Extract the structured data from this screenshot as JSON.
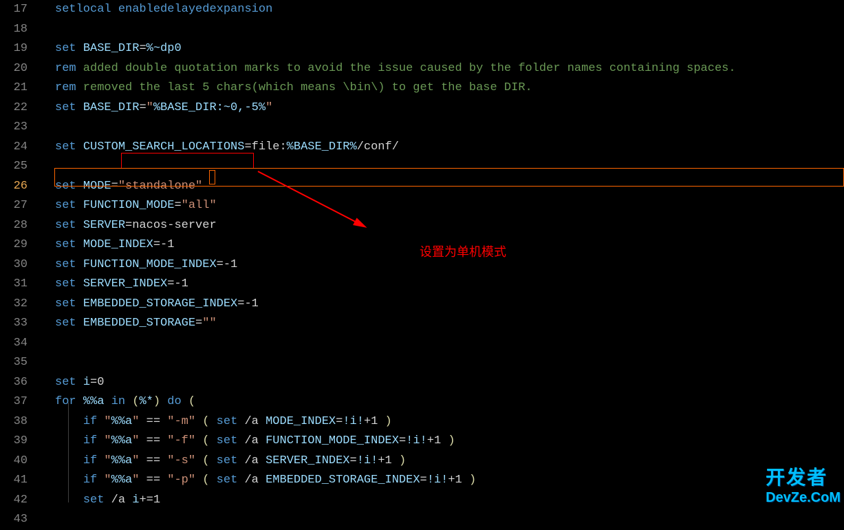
{
  "annotation_text": "设置为单机模式",
  "watermark_cn": "开发者",
  "watermark_en": "DevZe.CoM",
  "line_numbers": [
    "17",
    "18",
    "19",
    "20",
    "21",
    "22",
    "23",
    "24",
    "25",
    "26",
    "27",
    "28",
    "29",
    "30",
    "31",
    "32",
    "33",
    "34",
    "35",
    "36",
    "37",
    "38",
    "39",
    "40",
    "41",
    "42",
    "43"
  ],
  "active_line_index": 9,
  "tokens": {
    "l17": [
      {
        "t": "setlocal",
        "c": "kw-blue"
      },
      {
        "t": " ",
        "c": "kw-white"
      },
      {
        "t": "enabledelayedexpansion",
        "c": "kw-blue"
      }
    ],
    "l18": [],
    "l19": [
      {
        "t": "set",
        "c": "kw-blue"
      },
      {
        "t": " ",
        "c": "kw-white"
      },
      {
        "t": "BASE_DIR",
        "c": "kw-cyan"
      },
      {
        "t": "=",
        "c": "kw-white"
      },
      {
        "t": "%~dp0",
        "c": "kw-cyan"
      }
    ],
    "l20": [
      {
        "t": "rem",
        "c": "kw-blue"
      },
      {
        "t": " added double quotation marks to avoid the issue caused by the folder names containing spaces.",
        "c": "kw-green"
      }
    ],
    "l21": [
      {
        "t": "rem",
        "c": "kw-blue"
      },
      {
        "t": " removed the last 5 chars(which means \\bin\\) to get the base DIR.",
        "c": "kw-green"
      }
    ],
    "l22": [
      {
        "t": "set",
        "c": "kw-blue"
      },
      {
        "t": " ",
        "c": "kw-white"
      },
      {
        "t": "BASE_DIR",
        "c": "kw-cyan"
      },
      {
        "t": "=",
        "c": "kw-white"
      },
      {
        "t": "\"",
        "c": "kw-orange"
      },
      {
        "t": "%BASE_DIR:~0,-5%",
        "c": "kw-cyan"
      },
      {
        "t": "\"",
        "c": "kw-orange"
      }
    ],
    "l23": [],
    "l24": [
      {
        "t": "set",
        "c": "kw-blue"
      },
      {
        "t": " ",
        "c": "kw-white"
      },
      {
        "t": "CUSTOM_SEARCH_LOCATIONS",
        "c": "kw-cyan"
      },
      {
        "t": "=file:",
        "c": "kw-white"
      },
      {
        "t": "%BASE_DIR%",
        "c": "kw-cyan"
      },
      {
        "t": "/conf/",
        "c": "kw-white"
      }
    ],
    "l25": [],
    "l26": [
      {
        "t": "set",
        "c": "kw-blue"
      },
      {
        "t": " ",
        "c": "kw-white"
      },
      {
        "t": "MODE",
        "c": "kw-cyan"
      },
      {
        "t": "=",
        "c": "kw-white"
      },
      {
        "t": "\"standalone\"",
        "c": "kw-orange"
      }
    ],
    "l27": [
      {
        "t": "set",
        "c": "kw-blue"
      },
      {
        "t": " ",
        "c": "kw-white"
      },
      {
        "t": "FUNCTION_MODE",
        "c": "kw-cyan"
      },
      {
        "t": "=",
        "c": "kw-white"
      },
      {
        "t": "\"all\"",
        "c": "kw-orange"
      }
    ],
    "l28": [
      {
        "t": "set",
        "c": "kw-blue"
      },
      {
        "t": " ",
        "c": "kw-white"
      },
      {
        "t": "SERVER",
        "c": "kw-cyan"
      },
      {
        "t": "=nacos-server",
        "c": "kw-white"
      }
    ],
    "l29": [
      {
        "t": "set",
        "c": "kw-blue"
      },
      {
        "t": " ",
        "c": "kw-white"
      },
      {
        "t": "MODE_INDEX",
        "c": "kw-cyan"
      },
      {
        "t": "=-1",
        "c": "kw-white"
      }
    ],
    "l30": [
      {
        "t": "set",
        "c": "kw-blue"
      },
      {
        "t": " ",
        "c": "kw-white"
      },
      {
        "t": "FUNCTION_MODE_INDEX",
        "c": "kw-cyan"
      },
      {
        "t": "=-1",
        "c": "kw-white"
      }
    ],
    "l31": [
      {
        "t": "set",
        "c": "kw-blue"
      },
      {
        "t": " ",
        "c": "kw-white"
      },
      {
        "t": "SERVER_INDEX",
        "c": "kw-cyan"
      },
      {
        "t": "=-1",
        "c": "kw-white"
      }
    ],
    "l32": [
      {
        "t": "set",
        "c": "kw-blue"
      },
      {
        "t": " ",
        "c": "kw-white"
      },
      {
        "t": "EMBEDDED_STORAGE_INDEX",
        "c": "kw-cyan"
      },
      {
        "t": "=-1",
        "c": "kw-white"
      }
    ],
    "l33": [
      {
        "t": "set",
        "c": "kw-blue"
      },
      {
        "t": " ",
        "c": "kw-white"
      },
      {
        "t": "EMBEDDED_STORAGE",
        "c": "kw-cyan"
      },
      {
        "t": "=",
        "c": "kw-white"
      },
      {
        "t": "\"\"",
        "c": "kw-orange"
      }
    ],
    "l34": [],
    "l35": [],
    "l36": [
      {
        "t": "set",
        "c": "kw-blue"
      },
      {
        "t": " ",
        "c": "kw-white"
      },
      {
        "t": "i",
        "c": "kw-cyan"
      },
      {
        "t": "=0",
        "c": "kw-white"
      }
    ],
    "l37": [
      {
        "t": "for",
        "c": "kw-blue"
      },
      {
        "t": " ",
        "c": "kw-white"
      },
      {
        "t": "%%a",
        "c": "kw-cyan"
      },
      {
        "t": " ",
        "c": "kw-white"
      },
      {
        "t": "in",
        "c": "kw-blue"
      },
      {
        "t": " (",
        "c": "kw-yellow"
      },
      {
        "t": "%*",
        "c": "kw-cyan"
      },
      {
        "t": ") ",
        "c": "kw-yellow"
      },
      {
        "t": "do",
        "c": "kw-blue"
      },
      {
        "t": " (",
        "c": "kw-yellow"
      }
    ],
    "l38": [
      {
        "t": "    ",
        "c": "kw-white"
      },
      {
        "t": "if",
        "c": "kw-blue"
      },
      {
        "t": " ",
        "c": "kw-white"
      },
      {
        "t": "\"",
        "c": "kw-orange"
      },
      {
        "t": "%%a",
        "c": "kw-cyan"
      },
      {
        "t": "\"",
        "c": "kw-orange"
      },
      {
        "t": " == ",
        "c": "kw-white"
      },
      {
        "t": "\"-m\"",
        "c": "kw-orange"
      },
      {
        "t": " ( ",
        "c": "kw-yellow"
      },
      {
        "t": "set",
        "c": "kw-blue"
      },
      {
        "t": " /a ",
        "c": "kw-white"
      },
      {
        "t": "MODE_INDEX",
        "c": "kw-cyan"
      },
      {
        "t": "=",
        "c": "kw-white"
      },
      {
        "t": "!i!",
        "c": "kw-cyan"
      },
      {
        "t": "+1 ",
        "c": "kw-white"
      },
      {
        "t": ")",
        "c": "kw-yellow"
      }
    ],
    "l39": [
      {
        "t": "    ",
        "c": "kw-white"
      },
      {
        "t": "if",
        "c": "kw-blue"
      },
      {
        "t": " ",
        "c": "kw-white"
      },
      {
        "t": "\"",
        "c": "kw-orange"
      },
      {
        "t": "%%a",
        "c": "kw-cyan"
      },
      {
        "t": "\"",
        "c": "kw-orange"
      },
      {
        "t": " == ",
        "c": "kw-white"
      },
      {
        "t": "\"-f\"",
        "c": "kw-orange"
      },
      {
        "t": " ( ",
        "c": "kw-yellow"
      },
      {
        "t": "set",
        "c": "kw-blue"
      },
      {
        "t": " /a ",
        "c": "kw-white"
      },
      {
        "t": "FUNCTION_MODE_INDEX",
        "c": "kw-cyan"
      },
      {
        "t": "=",
        "c": "kw-white"
      },
      {
        "t": "!i!",
        "c": "kw-cyan"
      },
      {
        "t": "+1 ",
        "c": "kw-white"
      },
      {
        "t": ")",
        "c": "kw-yellow"
      }
    ],
    "l40": [
      {
        "t": "    ",
        "c": "kw-white"
      },
      {
        "t": "if",
        "c": "kw-blue"
      },
      {
        "t": " ",
        "c": "kw-white"
      },
      {
        "t": "\"",
        "c": "kw-orange"
      },
      {
        "t": "%%a",
        "c": "kw-cyan"
      },
      {
        "t": "\"",
        "c": "kw-orange"
      },
      {
        "t": " == ",
        "c": "kw-white"
      },
      {
        "t": "\"-s\"",
        "c": "kw-orange"
      },
      {
        "t": " ( ",
        "c": "kw-yellow"
      },
      {
        "t": "set",
        "c": "kw-blue"
      },
      {
        "t": " /a ",
        "c": "kw-white"
      },
      {
        "t": "SERVER_INDEX",
        "c": "kw-cyan"
      },
      {
        "t": "=",
        "c": "kw-white"
      },
      {
        "t": "!i!",
        "c": "kw-cyan"
      },
      {
        "t": "+1 ",
        "c": "kw-white"
      },
      {
        "t": ")",
        "c": "kw-yellow"
      }
    ],
    "l41": [
      {
        "t": "    ",
        "c": "kw-white"
      },
      {
        "t": "if",
        "c": "kw-blue"
      },
      {
        "t": " ",
        "c": "kw-white"
      },
      {
        "t": "\"",
        "c": "kw-orange"
      },
      {
        "t": "%%a",
        "c": "kw-cyan"
      },
      {
        "t": "\"",
        "c": "kw-orange"
      },
      {
        "t": " == ",
        "c": "kw-white"
      },
      {
        "t": "\"-p\"",
        "c": "kw-orange"
      },
      {
        "t": " ( ",
        "c": "kw-yellow"
      },
      {
        "t": "set",
        "c": "kw-blue"
      },
      {
        "t": " /a ",
        "c": "kw-white"
      },
      {
        "t": "EMBEDDED_STORAGE_INDEX",
        "c": "kw-cyan"
      },
      {
        "t": "=",
        "c": "kw-white"
      },
      {
        "t": "!i!",
        "c": "kw-cyan"
      },
      {
        "t": "+1 ",
        "c": "kw-white"
      },
      {
        "t": ")",
        "c": "kw-yellow"
      }
    ],
    "l42": [
      {
        "t": "    ",
        "c": "kw-white"
      },
      {
        "t": "set",
        "c": "kw-blue"
      },
      {
        "t": " /a ",
        "c": "kw-white"
      },
      {
        "t": "i",
        "c": "kw-cyan"
      },
      {
        "t": "+=1",
        "c": "kw-white"
      }
    ],
    "l43": []
  }
}
